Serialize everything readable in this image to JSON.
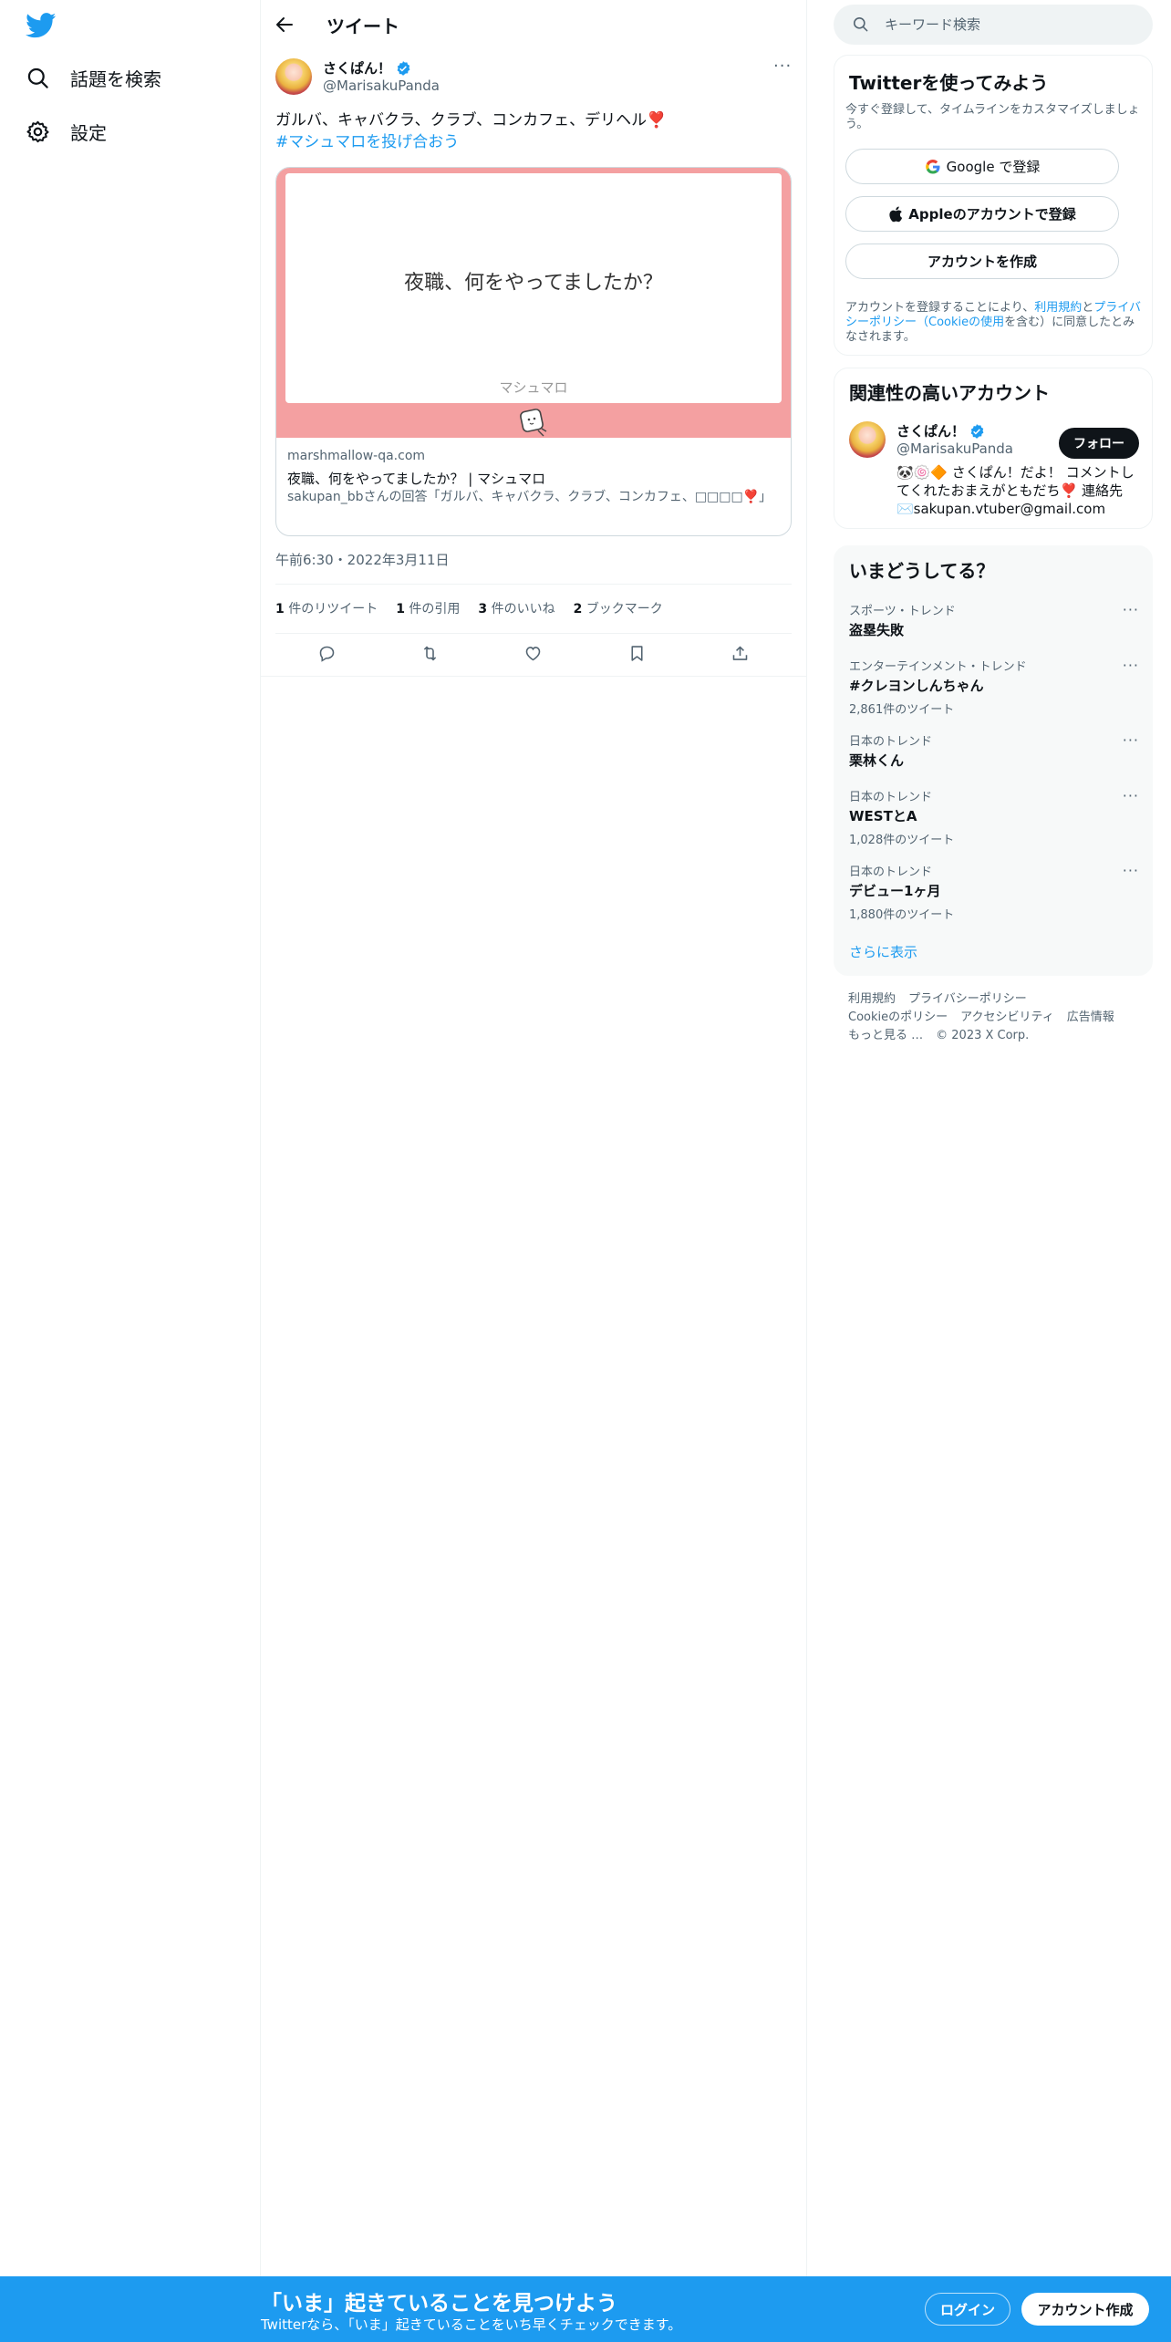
{
  "nav": {
    "explore_label": "話題を検索",
    "settings_label": "設定"
  },
  "header": {
    "title": "ツイート"
  },
  "tweet": {
    "author_name": "さくぱん！",
    "author_handle": "@MarisakuPanda",
    "text": "ガルバ、キャバクラ、クラブ、コンカフェ、デリヘル❣️",
    "hashtag": "#マシュマロを投げ合おう",
    "card": {
      "question": "夜職、何をやってましたか？",
      "brand": "マシュマロ",
      "domain": "marshmallow-qa.com",
      "title": "夜職、何をやってましたか？ | マシュマロ",
      "description": "sakupan_bbさんの回答「ガルバ、キャバクラ、クラブ、コンカフェ、□□□□❣️」"
    },
    "timestamp": "午前6:30・2022年3月11日",
    "stats": {
      "retweets_count": "1",
      "retweets_label": "件のリツイート",
      "quotes_count": "1",
      "quotes_label": "件の引用",
      "likes_count": "3",
      "likes_label": "件のいいね",
      "bookmarks_count": "2",
      "bookmarks_label": "ブックマーク"
    }
  },
  "search": {
    "placeholder": "キーワード検索"
  },
  "signup_box": {
    "title": "Twitterを使ってみよう",
    "subtitle": "今すぐ登録して、タイムラインをカスタマイズしましょう。",
    "google_label": "Google で登録",
    "apple_label": "Appleのアカウントで登録",
    "create_label": "アカウントを作成",
    "terms_prefix": "アカウントを登録することにより、",
    "terms_link": "利用規約",
    "terms_and": "と",
    "privacy_link": "プライバシーポリシー",
    "cookie_open": "（",
    "cookie_link": "Cookieの使用",
    "terms_suffix": "を含む）に同意したとみなされます。"
  },
  "related": {
    "title": "関連性の高いアカウント",
    "name": "さくぱん！",
    "handle": "@MarisakuPanda",
    "follow_label": "フォロー",
    "bio": "🐼🍥🔶 さくぱん！だよ！ コメントしてくれたおまえがともだち❣️ 連絡先✉️sakupan.vtuber@gmail.com"
  },
  "trends": {
    "title": "いまどうしてる？",
    "items": [
      {
        "category": "スポーツ・トレンド",
        "name": "盗塁失敗",
        "count": ""
      },
      {
        "category": "エンターテインメント・トレンド",
        "name": "#クレヨンしんちゃん",
        "count": "2,861件のツイート"
      },
      {
        "category": "日本のトレンド",
        "name": "栗林くん",
        "count": ""
      },
      {
        "category": "日本のトレンド",
        "name": "WESTとA",
        "count": "1,028件のツイート"
      },
      {
        "category": "日本のトレンド",
        "name": "デビュー1ヶ月",
        "count": "1,880件のツイート"
      }
    ],
    "show_more": "さらに表示"
  },
  "footer": {
    "terms": "利用規約",
    "privacy": "プライバシーポリシー",
    "cookie": "Cookieのポリシー",
    "accessibility": "アクセシビリティ",
    "ads": "広告情報",
    "more": "もっと見る …",
    "copyright": "© 2023 X Corp."
  },
  "banner": {
    "title": "「いま」起きていることを見つけよう",
    "subtitle": "Twitterなら、「いま」起きていることをいち早くチェックできます。",
    "login_label": "ログイン",
    "signup_label": "アカウント作成"
  },
  "colors": {
    "accent": "#1d9bf0",
    "card_bg": "#f4a0a1",
    "text": "#0f1419",
    "muted": "#536471"
  }
}
